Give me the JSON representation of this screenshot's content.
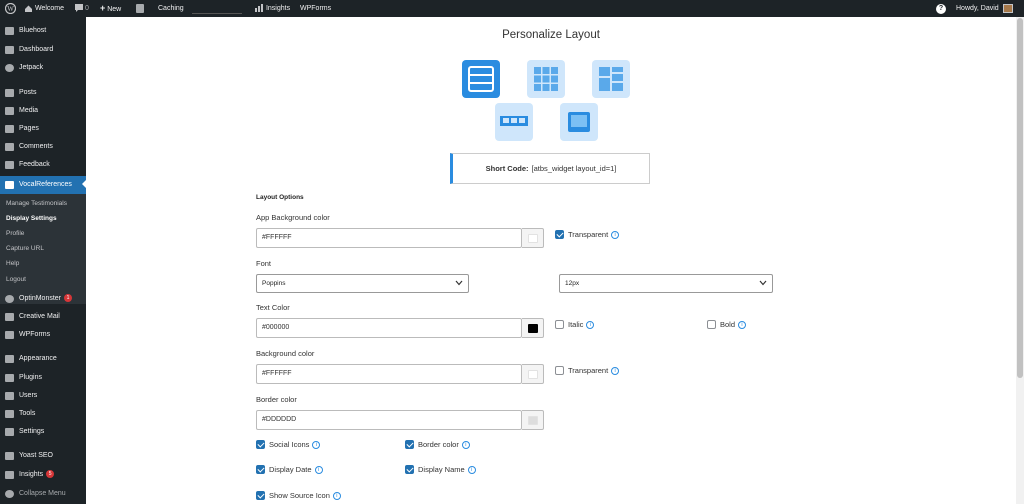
{
  "admin_bar": {
    "site_name": "Welcome",
    "comments_count": "0",
    "new_label": "New",
    "caching_label": "Caching",
    "insights_label": "Insights",
    "wpforms_label": "WPForms",
    "greeting": "Howdy, David",
    "help_label": "?"
  },
  "sidebar": {
    "items": [
      {
        "label": "Bluehost",
        "icon": "grid-icon"
      },
      {
        "label": "Dashboard",
        "icon": "dashboard-icon"
      },
      {
        "label": "Jetpack",
        "icon": "jetpack-icon"
      },
      {
        "label": "Posts",
        "icon": "pin-icon"
      },
      {
        "label": "Media",
        "icon": "media-icon"
      },
      {
        "label": "Pages",
        "icon": "pages-icon"
      },
      {
        "label": "Comments",
        "icon": "comment-icon"
      },
      {
        "label": "Feedback",
        "icon": "feedback-icon"
      },
      {
        "label": "VocalReferences",
        "icon": "vocal-icon"
      },
      {
        "label": "OptinMonster",
        "icon": "optinmonster-icon",
        "badge": "1"
      },
      {
        "label": "Creative Mail",
        "icon": "mail-icon"
      },
      {
        "label": "WPForms",
        "icon": "wpforms-icon"
      },
      {
        "label": "Appearance",
        "icon": "brush-icon"
      },
      {
        "label": "Plugins",
        "icon": "plugin-icon"
      },
      {
        "label": "Users",
        "icon": "users-icon"
      },
      {
        "label": "Tools",
        "icon": "wrench-icon"
      },
      {
        "label": "Settings",
        "icon": "settings-icon"
      },
      {
        "label": "Yoast SEO",
        "icon": "yoast-icon"
      },
      {
        "label": "Insights",
        "icon": "insights-icon",
        "badge": "5"
      },
      {
        "label": "Collapse Menu",
        "icon": "collapse-icon"
      }
    ],
    "submenu": [
      "Manage Testimonials",
      "Display Settings",
      "Profile",
      "Capture URL",
      "Help",
      "Logout"
    ]
  },
  "page": {
    "title": "Personalize Layout",
    "shortcode_label": "Short Code:",
    "shortcode_value": "[atbs_widget layout_id=1]",
    "section_title": "Layout Options",
    "app_bg_label": "App Background color",
    "app_bg_value": "#FFFFFF",
    "transparent_label": "Transparent",
    "font_label": "Font",
    "font_value": "Poppins",
    "font_size_value": "12px",
    "text_color_label": "Text Color",
    "text_color_value": "#000000",
    "italic_label": "Italic",
    "bold_label": "Bold",
    "bg_color_label": "Background color",
    "bg_color_value": "#FFFFFF",
    "bg_transparent_label": "Transparent",
    "border_color_label": "Border color",
    "border_color_value": "#DDDDDD",
    "social_icons_label": "Social Icons",
    "border_color_cb_label": "Border color",
    "display_date_label": "Display Date",
    "display_name_label": "Display Name",
    "show_source_label": "Show Source Icon"
  },
  "state": {
    "app_bg_transparent": true,
    "italic": false,
    "bold": false,
    "bg_transparent": false,
    "social_icons": true,
    "border_color": true,
    "display_date": true,
    "display_name": true,
    "show_source_icon": true
  },
  "colors": {
    "accent": "#2a8ce0",
    "admin_dark": "#1d2327",
    "menu_active": "#2271b1",
    "text_swatch": "#000000",
    "border_swatch": "#DDDDDD"
  }
}
